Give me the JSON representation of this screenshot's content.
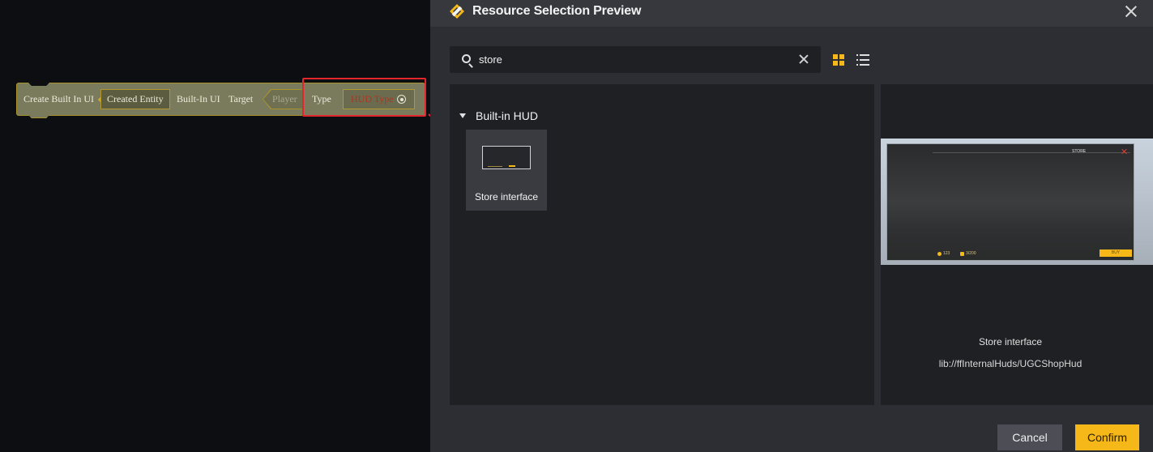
{
  "node": {
    "title": "Create Built In UI",
    "entity_label": "Created Entity",
    "builtin_label": "Built-In UI",
    "target_label": "Target",
    "target_value": "Player",
    "type_label": "Type",
    "type_value": "HUD Type"
  },
  "dialog": {
    "title": "Resource Selection Preview",
    "search": {
      "value": "store",
      "placeholder": ""
    },
    "view_modes": [
      "grid-icon",
      "list-icon"
    ],
    "section": {
      "label": "Built-in HUD"
    },
    "items": [
      {
        "label": "Store interface",
        "icon": "store-thumbnail"
      }
    ],
    "preview": {
      "screen_title": "STORE",
      "coin_value": "123",
      "capacity_value": "3/200",
      "buy_label": "BUY",
      "name": "Store interface",
      "path": "lib://ffInternalHuds/UGCShopHud"
    },
    "buttons": {
      "cancel": "Cancel",
      "confirm": "Confirm"
    }
  },
  "colors": {
    "accent": "#f6b818",
    "highlight": "#e3262b",
    "node_fill": "#7a7a5c",
    "node_border": "#a8922e"
  }
}
